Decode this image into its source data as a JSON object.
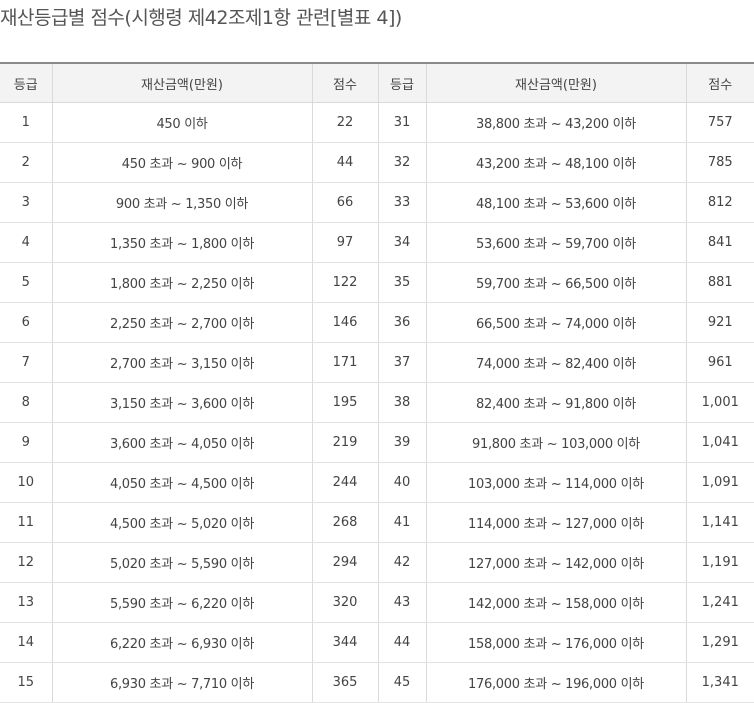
{
  "title": "재산등급별 점수(시행령 제42조제1항 관련[별표 4])",
  "headers": [
    "등급",
    "재산금액(만원)",
    "점수",
    "등급",
    "재산금액(만원)",
    "점수"
  ],
  "rows": [
    {
      "g1": "1",
      "a1": "450 이하",
      "s1": "22",
      "g2": "31",
      "a2": "38,800 초과 ~ 43,200 이하",
      "s2": "757"
    },
    {
      "g1": "2",
      "a1": "450 초과 ~ 900 이하",
      "s1": "44",
      "g2": "32",
      "a2": "43,200 초과 ~ 48,100 이하",
      "s2": "785"
    },
    {
      "g1": "3",
      "a1": "900 초과 ~ 1,350 이하",
      "s1": "66",
      "g2": "33",
      "a2": "48,100 초과 ~ 53,600 이하",
      "s2": "812"
    },
    {
      "g1": "4",
      "a1": "1,350 초과 ~ 1,800 이하",
      "s1": "97",
      "g2": "34",
      "a2": "53,600 초과 ~ 59,700 이하",
      "s2": "841"
    },
    {
      "g1": "5",
      "a1": "1,800 초과 ~ 2,250 이하",
      "s1": "122",
      "g2": "35",
      "a2": "59,700 초과 ~ 66,500 이하",
      "s2": "881"
    },
    {
      "g1": "6",
      "a1": "2,250 초과 ~ 2,700 이하",
      "s1": "146",
      "g2": "36",
      "a2": "66,500 초과 ~ 74,000 이하",
      "s2": "921"
    },
    {
      "g1": "7",
      "a1": "2,700 초과 ~ 3,150 이하",
      "s1": "171",
      "g2": "37",
      "a2": "74,000 초과 ~ 82,400 이하",
      "s2": "961"
    },
    {
      "g1": "8",
      "a1": "3,150 초과 ~ 3,600 이하",
      "s1": "195",
      "g2": "38",
      "a2": "82,400 초과 ~ 91,800 이하",
      "s2": "1,001"
    },
    {
      "g1": "9",
      "a1": "3,600 초과 ~ 4,050 이하",
      "s1": "219",
      "g2": "39",
      "a2": "91,800 초과 ~ 103,000 이하",
      "s2": "1,041"
    },
    {
      "g1": "10",
      "a1": "4,050 초과 ~ 4,500 이하",
      "s1": "244",
      "g2": "40",
      "a2": "103,000 초과 ~ 114,000 이하",
      "s2": "1,091"
    },
    {
      "g1": "11",
      "a1": "4,500 초과 ~ 5,020 이하",
      "s1": "268",
      "g2": "41",
      "a2": "114,000 초과 ~ 127,000 이하",
      "s2": "1,141"
    },
    {
      "g1": "12",
      "a1": "5,020 초과 ~ 5,590 이하",
      "s1": "294",
      "g2": "42",
      "a2": "127,000 초과 ~ 142,000 이하",
      "s2": "1,191"
    },
    {
      "g1": "13",
      "a1": "5,590 초과 ~ 6,220 이하",
      "s1": "320",
      "g2": "43",
      "a2": "142,000 초과 ~ 158,000 이하",
      "s2": "1,241"
    },
    {
      "g1": "14",
      "a1": "6,220 초과 ~ 6,930 이하",
      "s1": "344",
      "g2": "44",
      "a2": "158,000 초과 ~ 176,000 이하",
      "s2": "1,291"
    },
    {
      "g1": "15",
      "a1": "6,930 초과 ~ 7,710 이하",
      "s1": "365",
      "g2": "45",
      "a2": "176,000 초과 ~ 196,000 이하",
      "s2": "1,341"
    }
  ]
}
